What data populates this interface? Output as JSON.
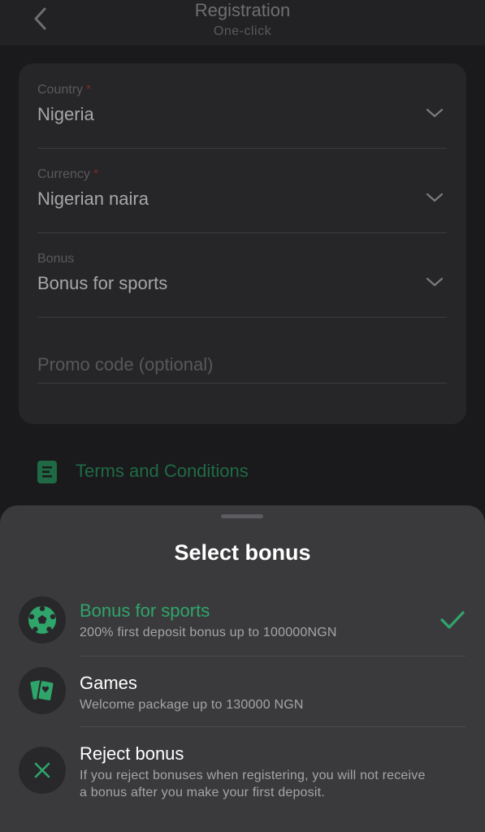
{
  "header": {
    "title": "Registration",
    "subtitle": "One-click"
  },
  "form": {
    "country": {
      "label": "Country",
      "required_mark": "*",
      "value": "Nigeria"
    },
    "currency": {
      "label": "Currency",
      "required_mark": "*",
      "value": "Nigerian naira"
    },
    "bonus": {
      "label": "Bonus",
      "value": "Bonus for sports"
    },
    "promo": {
      "placeholder": "Promo code (optional)"
    }
  },
  "terms": {
    "label": "Terms and Conditions"
  },
  "sheet": {
    "title": "Select bonus",
    "options": [
      {
        "title": "Bonus for sports",
        "description": "200% first deposit bonus up to 100000NGN",
        "icon": "soccer-ball-icon",
        "selected": true
      },
      {
        "title": "Games",
        "description": "Welcome package up to 130000 NGN",
        "icon": "playing-cards-icon",
        "selected": false
      },
      {
        "title": "Reject bonus",
        "description": "If you reject bonuses when registering, you will not receive a bonus after you make your first deposit.",
        "icon": "close-icon",
        "selected": false
      }
    ]
  },
  "colors": {
    "accent": "#2fa56b",
    "accent_dim": "#1f6a45",
    "required": "#7a2a26",
    "sheet_bg": "#3a3a3c",
    "page_bg": "#1a1a1c"
  }
}
